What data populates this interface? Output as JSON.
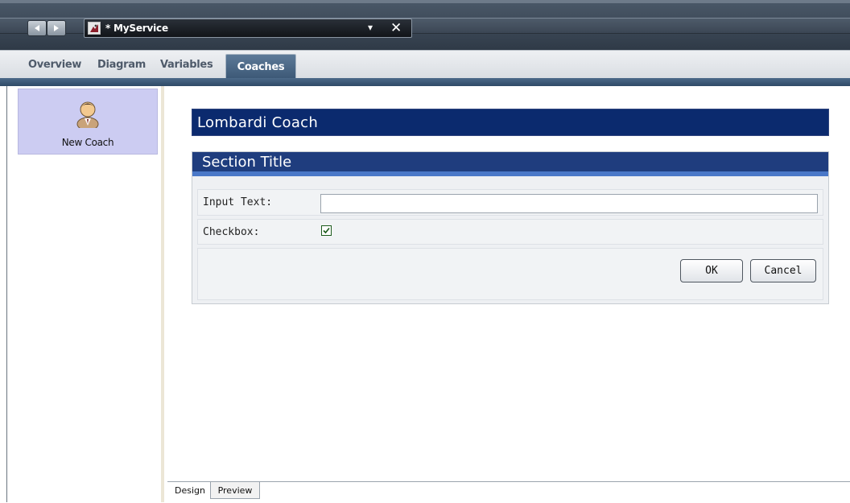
{
  "titlebar": {
    "back_icon": "back-arrow-icon",
    "forward_icon": "forward-arrow-icon",
    "document_icon": "service-icon",
    "document_title": "* MyService",
    "dropdown_icon": "dropdown-arrow-icon",
    "close_icon": "close-icon",
    "close_glyph": "✕",
    "dropdown_glyph": "▾"
  },
  "editor_tabs": [
    {
      "label": "Overview"
    },
    {
      "label": "Diagram"
    },
    {
      "label": "Variables"
    },
    {
      "label": "Coaches",
      "active": true
    }
  ],
  "palette": {
    "items": [
      {
        "label": "New Coach",
        "icon": "user-icon"
      }
    ]
  },
  "coach": {
    "header_title": "Lombardi Coach",
    "section_title": "Section Title",
    "input_label": "Input Text:",
    "input_value": "",
    "checkbox_label": "Checkbox:",
    "checkbox_checked": true,
    "ok_label": "OK",
    "cancel_label": "Cancel"
  },
  "bottom_tabs": [
    {
      "label": "Design",
      "active": true
    },
    {
      "label": "Preview",
      "active": false
    }
  ],
  "colors": {
    "coach_header_bg": "#0b2a6e",
    "section_header_bg": "#1f3d7e",
    "section_accent": "#4a78c8",
    "active_tab_bg": "#3c5876",
    "palette_selected_bg": "#ccccf2"
  }
}
